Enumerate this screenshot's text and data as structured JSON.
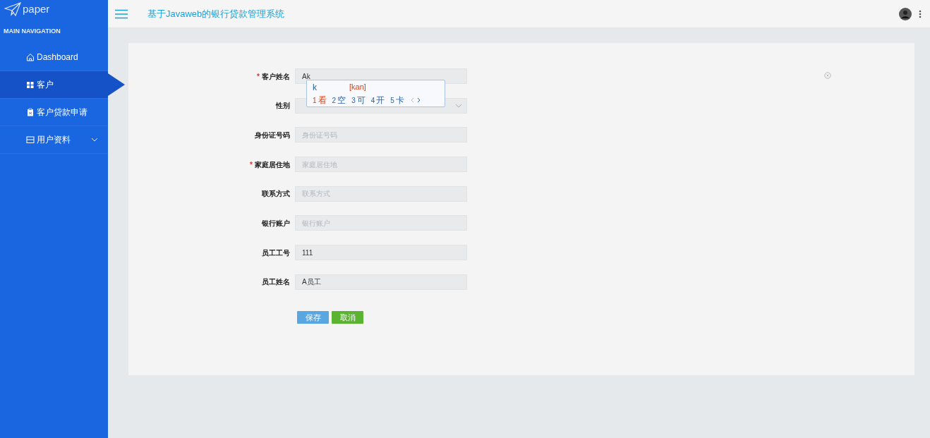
{
  "brand": {
    "name": "paper"
  },
  "sidebar": {
    "heading": "MAIN NAVIGATION",
    "items": [
      {
        "label": "Dashboard",
        "kind": "home",
        "selected": false,
        "expandable": false
      },
      {
        "label": "客户",
        "kind": "grid",
        "selected": true,
        "expandable": false
      },
      {
        "label": "客户贷款申请",
        "kind": "clipboard",
        "selected": false,
        "expandable": false
      },
      {
        "label": "用户资料",
        "kind": "card",
        "selected": false,
        "expandable": true
      }
    ]
  },
  "header": {
    "title": "基于Javaweb的银行贷款管理系统"
  },
  "form": {
    "fields": [
      {
        "label": "客户姓名",
        "required_mark": "*",
        "kind": "text",
        "value": "Ak"
      },
      {
        "label": "性别",
        "kind": "select"
      },
      {
        "label": "身份证号码",
        "kind": "text",
        "placeholder": "身份证号码"
      },
      {
        "label": "家庭居住地",
        "required_mark": "*",
        "kind": "text",
        "placeholder": "家庭居住地"
      },
      {
        "label": "联系方式",
        "kind": "text",
        "placeholder": "联系方式"
      },
      {
        "label": "银行账户",
        "kind": "text",
        "placeholder": "银行账户"
      },
      {
        "label": "员工工号",
        "kind": "text",
        "value": "111"
      },
      {
        "label": "员工姓名",
        "kind": "text",
        "value": "A员工"
      }
    ],
    "buttons": [
      {
        "label": "保存",
        "kind": "primary"
      },
      {
        "label": "取消",
        "kind": "success"
      }
    ]
  },
  "ime": {
    "composition": "k",
    "pinyin": "[kan]",
    "candidates": [
      {
        "number": "1",
        "text": "看",
        "selected": true
      },
      {
        "number": "2",
        "text": "空",
        "selected": false
      },
      {
        "number": "3",
        "text": "可",
        "selected": false
      },
      {
        "number": "4",
        "text": "开",
        "selected": false
      },
      {
        "number": "5",
        "text": "卡",
        "selected": false
      }
    ]
  }
}
